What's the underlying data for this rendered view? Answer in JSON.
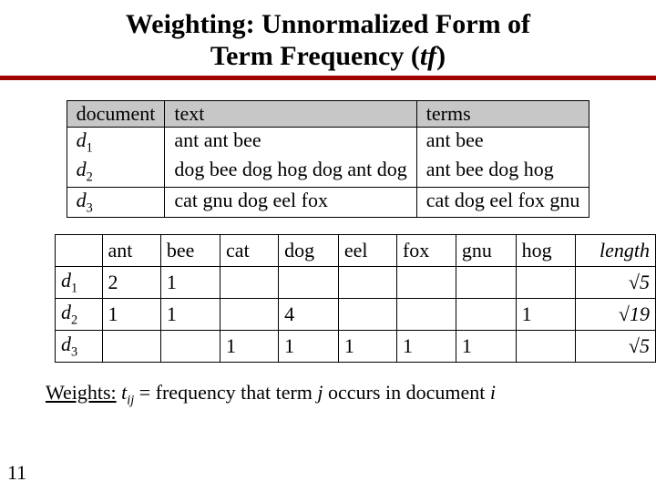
{
  "title_line1": "Weighting: Unnormalized Form of",
  "title_line2": "Term Frequency (",
  "title_tf": "tf",
  "title_close": ")",
  "doc_table": {
    "headers": {
      "c0": "document",
      "c1": "text",
      "c2": "terms"
    },
    "rows": [
      {
        "doc": "d",
        "sub": "1",
        "text": "ant ant bee",
        "terms": "ant bee"
      },
      {
        "doc": "d",
        "sub": "2",
        "text": "dog bee dog hog dog ant dog",
        "terms": "ant bee dog hog"
      },
      {
        "doc": "d",
        "sub": "3",
        "text": "cat gnu dog eel fox",
        "terms": "cat dog eel fox gnu"
      }
    ]
  },
  "tf_table": {
    "cols": [
      "ant",
      "bee",
      "cat",
      "dog",
      "eel",
      "fox",
      "gnu",
      "hog"
    ],
    "length_label": "length",
    "rows": [
      {
        "doc": "d",
        "sub": "1",
        "vals": [
          "2",
          "1",
          "",
          "",
          "",
          "",
          "",
          ""
        ],
        "len": "√5"
      },
      {
        "doc": "d",
        "sub": "2",
        "vals": [
          "1",
          "1",
          "",
          "4",
          "",
          "",
          "",
          "1"
        ],
        "len": "√19"
      },
      {
        "doc": "d",
        "sub": "3",
        "vals": [
          "",
          "",
          "1",
          "1",
          "1",
          "1",
          "1",
          ""
        ],
        "len": "√5"
      }
    ]
  },
  "footnote": {
    "label": "Weights:",
    "t": "t",
    "ij": "ij",
    "rest1": " = frequency that term ",
    "j": "j",
    "rest2": " occurs in document ",
    "i": "i"
  },
  "page_number": "11",
  "chart_data": {
    "type": "table",
    "title": "Unnormalized term frequency (tf) matrix",
    "columns": [
      "ant",
      "bee",
      "cat",
      "dog",
      "eel",
      "fox",
      "gnu",
      "hog",
      "length"
    ],
    "rows": {
      "d1": {
        "ant": 2,
        "bee": 1,
        "cat": 0,
        "dog": 0,
        "eel": 0,
        "fox": 0,
        "gnu": 0,
        "hog": 0,
        "length": "sqrt(5)"
      },
      "d2": {
        "ant": 1,
        "bee": 1,
        "cat": 0,
        "dog": 4,
        "eel": 0,
        "fox": 0,
        "gnu": 0,
        "hog": 1,
        "length": "sqrt(19)"
      },
      "d3": {
        "ant": 0,
        "bee": 0,
        "cat": 1,
        "dog": 1,
        "eel": 1,
        "fox": 1,
        "gnu": 1,
        "hog": 0,
        "length": "sqrt(5)"
      }
    }
  }
}
